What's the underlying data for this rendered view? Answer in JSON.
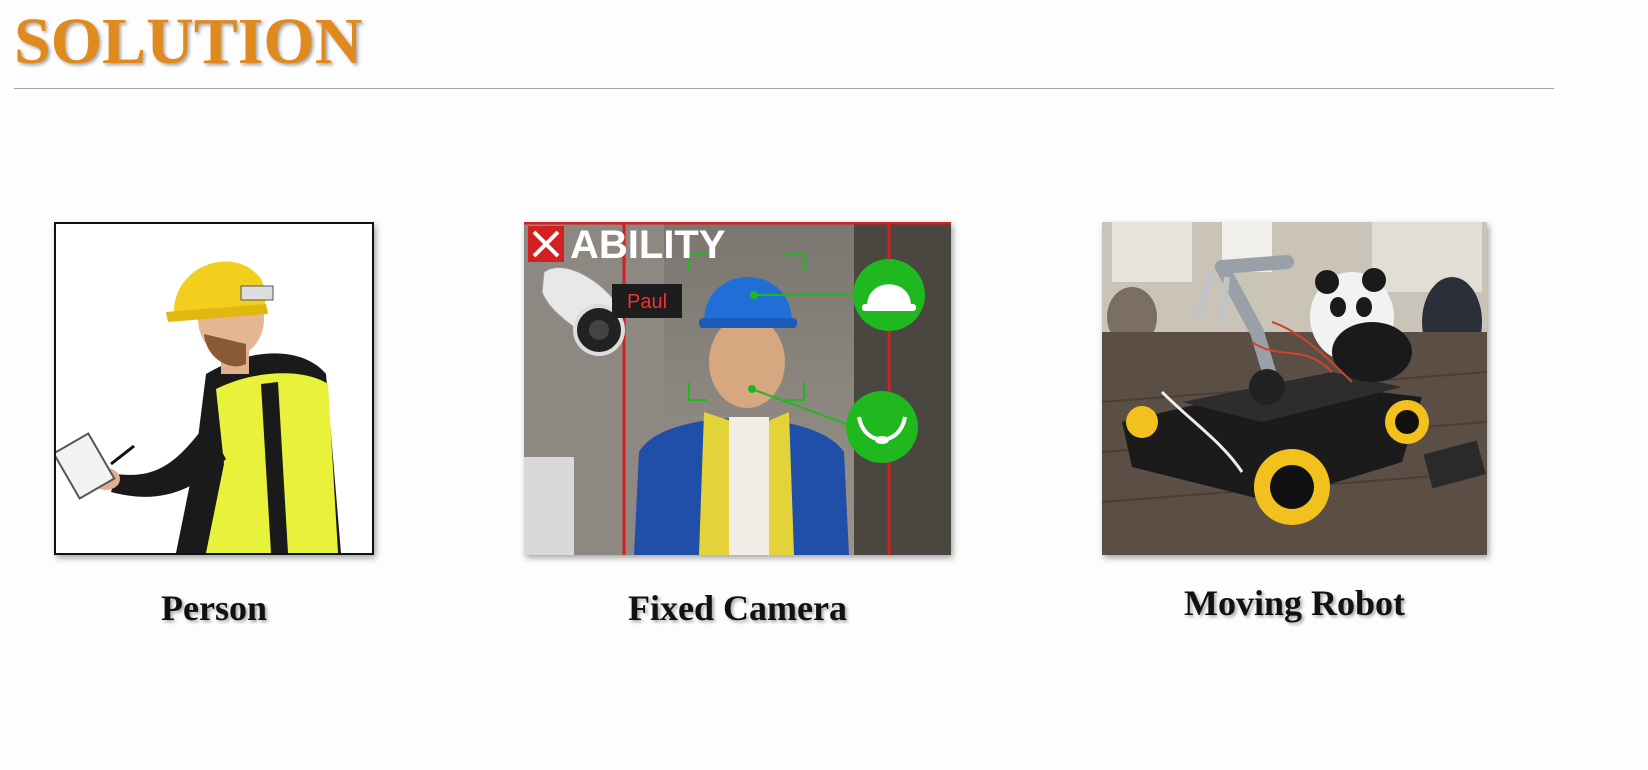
{
  "slide": {
    "title": "SOLUTION"
  },
  "panels": [
    {
      "caption": "Person",
      "image": "construction-worker-with-clipboard-photo"
    },
    {
      "caption": "Fixed Camera",
      "image": "cctv-helmet-detection-photo",
      "overlay_brand": "ABILITY",
      "overlay_name_tag": "Paul",
      "icons": [
        "hard-hat-icon",
        "chin-strap-icon",
        "cctv-camera-icon"
      ]
    },
    {
      "caption": "Moving Robot",
      "image": "mecanum-wheel-robot-arm-photo"
    }
  ],
  "colors": {
    "title": "#e08a1e",
    "detection_green": "#1fb81f",
    "alert_red": "#d42020"
  }
}
